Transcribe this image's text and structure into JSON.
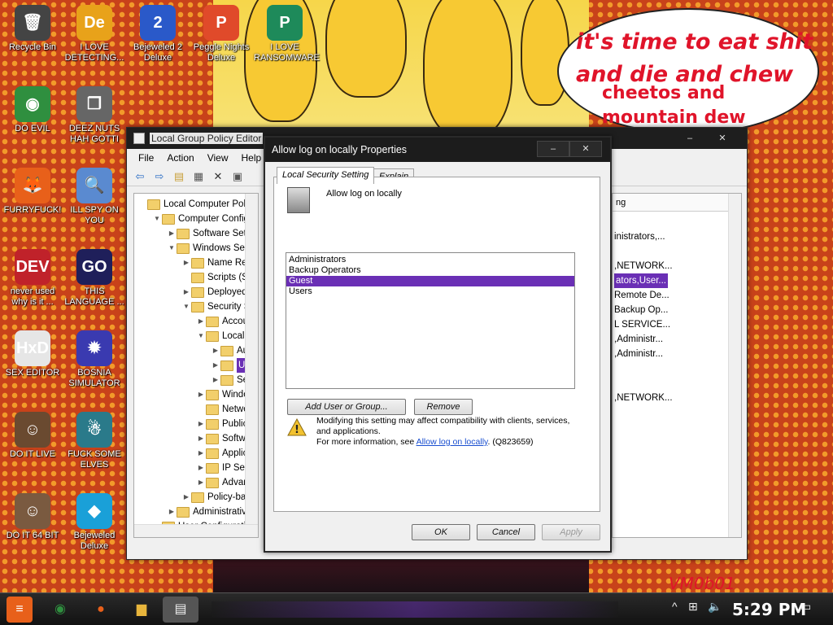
{
  "wallpaper": {
    "bubble_lines": [
      "it's time to eat shit",
      "and die and chew",
      "cheetos and",
      "mountain dew"
    ],
    "corner_text": "VM0b01"
  },
  "desktop_icons": [
    {
      "label": "Recycle Bin",
      "icon": "recycle-bin-icon",
      "glyph": "🗑",
      "color": "#444444"
    },
    {
      "label": "I LOVE DETECTING...",
      "icon": "de-app-icon",
      "glyph": "De",
      "color": "#e8a21a"
    },
    {
      "label": "Bejeweled 2 Deluxe",
      "icon": "bejeweled2-icon",
      "glyph": "2",
      "color": "#2a59c9"
    },
    {
      "label": "Peggle Nights Deluxe",
      "icon": "peggle-icon",
      "glyph": "P",
      "color": "#e04a2a"
    },
    {
      "label": "I LOVE RANSOMWARE",
      "icon": "publisher-icon",
      "glyph": "P",
      "color": "#1e8a5a"
    },
    {
      "label": "DO EVIL",
      "icon": "chrome-icon",
      "glyph": "◉",
      "color": "#2f8f3f"
    },
    {
      "label": "DEEZ NUTS HAH GOTTI",
      "icon": "windows-stack-icon",
      "glyph": "❐",
      "color": "#666666"
    },
    {
      "label": "FURRYFUCK!",
      "icon": "firefox-icon",
      "glyph": "🦊",
      "color": "#e8601a"
    },
    {
      "label": "ILL SPY ON YOU",
      "icon": "spy-icon",
      "glyph": "🔍",
      "color": "#5a8ad0"
    },
    {
      "label": "never used why is it ...",
      "icon": "devcpp-icon",
      "glyph": "DEV",
      "color": "#c0222a"
    },
    {
      "label": "THIS LANGUAGE ...",
      "icon": "go-icon",
      "glyph": "GO",
      "color": "#1f1f5a"
    },
    {
      "label": "SEX EDITOR",
      "icon": "hxd-icon",
      "glyph": "HxD",
      "color": "#e6e6e6"
    },
    {
      "label": "BOSNIA SIMULATOR",
      "icon": "mine-icon",
      "glyph": "✹",
      "color": "#3a3ab0"
    },
    {
      "label": "DO IT LIVE",
      "icon": "portrait-icon",
      "glyph": "☺",
      "color": "#6a4a30"
    },
    {
      "label": "FUCK SOME ELVES",
      "icon": "elves-icon",
      "glyph": "☃",
      "color": "#2a7a8a"
    },
    {
      "label": "DO IT 64 BIT",
      "icon": "portrait64-icon",
      "glyph": "☺",
      "color": "#7a5a40"
    },
    {
      "label": "Bejeweled Deluxe",
      "icon": "bejeweled-icon",
      "glyph": "◆",
      "color": "#1aa0d8"
    }
  ],
  "gpedit": {
    "title": "Local Group Policy Editor",
    "menu": [
      "File",
      "Action",
      "View",
      "Help"
    ],
    "tree": [
      {
        "label": "Local Computer Policy",
        "indent": 0,
        "fold": ""
      },
      {
        "label": "Computer Configuration",
        "indent": 1,
        "fold": "▼"
      },
      {
        "label": "Software Settings",
        "indent": 2,
        "fold": "▶"
      },
      {
        "label": "Windows Settings",
        "indent": 2,
        "fold": "▼"
      },
      {
        "label": "Name Resolution Policy",
        "indent": 3,
        "fold": "▶"
      },
      {
        "label": "Scripts (Startup/Shutdown)",
        "indent": 3,
        "fold": ""
      },
      {
        "label": "Deployed Printers",
        "indent": 3,
        "fold": "▶"
      },
      {
        "label": "Security Settings",
        "indent": 3,
        "fold": "▼"
      },
      {
        "label": "Account Policies",
        "indent": 4,
        "fold": "▶"
      },
      {
        "label": "Local Policies",
        "indent": 4,
        "fold": "▼"
      },
      {
        "label": "Audit Policy",
        "indent": 5,
        "fold": "▶"
      },
      {
        "label": "User Rights Assignment",
        "indent": 5,
        "fold": "▶",
        "selected": true
      },
      {
        "label": "Security Options",
        "indent": 5,
        "fold": "▶"
      },
      {
        "label": "Windows Firewall",
        "indent": 4,
        "fold": "▶"
      },
      {
        "label": "Network List Manager",
        "indent": 4,
        "fold": ""
      },
      {
        "label": "Public Key Policies",
        "indent": 4,
        "fold": "▶"
      },
      {
        "label": "Software Restriction",
        "indent": 4,
        "fold": "▶"
      },
      {
        "label": "Application Control",
        "indent": 4,
        "fold": "▶"
      },
      {
        "label": "IP Security Policies",
        "indent": 4,
        "fold": "▶"
      },
      {
        "label": "Advanced Audit",
        "indent": 4,
        "fold": "▶"
      },
      {
        "label": "Policy-based QoS",
        "indent": 3,
        "fold": "▶"
      },
      {
        "label": "Administrative Templates",
        "indent": 2,
        "fold": "▶"
      },
      {
        "label": "User Configuration",
        "indent": 1,
        "fold": "▼"
      }
    ],
    "right_header": "ng",
    "right_rows": [
      {
        "text": "inistrators,...",
        "selected": false
      },
      {
        "text": "",
        "selected": false
      },
      {
        "text": ",NETWORK...",
        "selected": false
      },
      {
        "text": "ators,User...",
        "selected": true
      },
      {
        "text": "Remote De...",
        "selected": false
      },
      {
        "text": "Backup Op...",
        "selected": false
      },
      {
        "text": "L SERVICE...",
        "selected": false
      },
      {
        "text": ",Administr...",
        "selected": false
      },
      {
        "text": ",Administr...",
        "selected": false
      },
      {
        "text": "",
        "selected": false
      },
      {
        "text": "",
        "selected": false
      },
      {
        "text": ",NETWORK...",
        "selected": false
      }
    ]
  },
  "dialog": {
    "title": "Allow log on locally Properties",
    "tabs": [
      "Local Security Setting",
      "Explain"
    ],
    "policy_name": "Allow log on locally",
    "members": [
      {
        "name": "Administrators",
        "selected": false
      },
      {
        "name": "Backup Operators",
        "selected": false
      },
      {
        "name": "Guest",
        "selected": true
      },
      {
        "name": "Users",
        "selected": false
      }
    ],
    "add_button": "Add User or Group...",
    "remove_button": "Remove",
    "warning_line1": "Modifying this setting may affect compatibility with clients, services,",
    "warning_line2": "and applications.",
    "more_info_prefix": "For more information, see ",
    "more_info_link": "Allow log on locally",
    "more_info_suffix": ". (Q823659)",
    "ok": "OK",
    "cancel": "Cancel",
    "apply": "Apply",
    "minimize": "–",
    "close": "✕"
  },
  "taskbar": {
    "clock": "5:29 PM",
    "items": [
      "start-button",
      "chrome-taskbar",
      "firefox-taskbar",
      "explorer-taskbar",
      "gpedit-taskbar"
    ]
  }
}
